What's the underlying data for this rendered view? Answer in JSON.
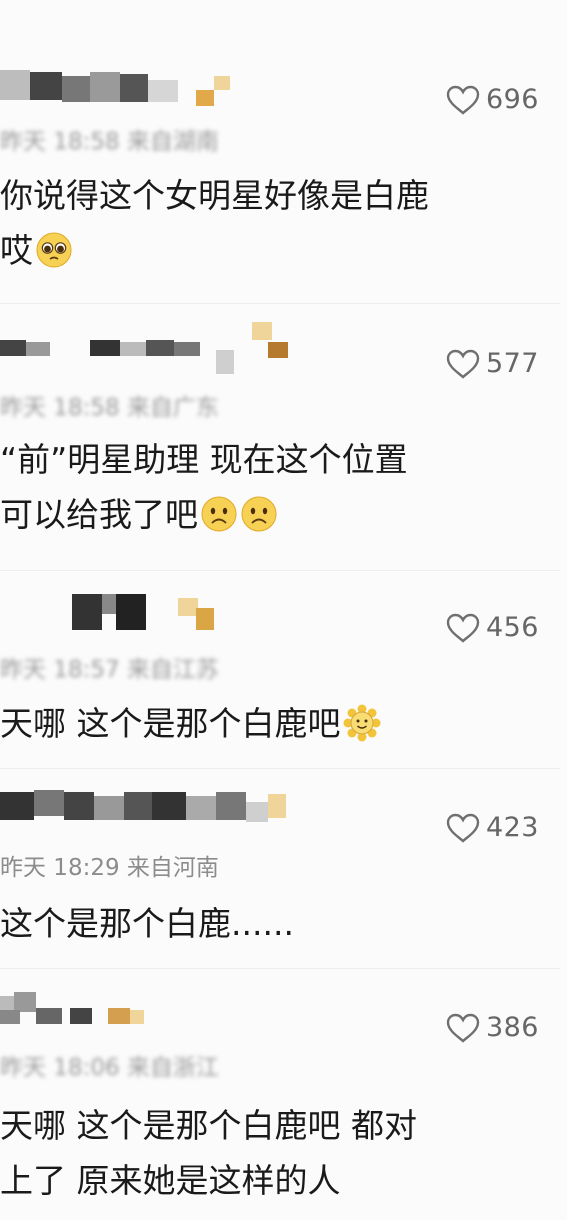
{
  "comments": [
    {
      "likes": "696",
      "meta": "昨天 18:58 来自湖南",
      "meta_obscured": true,
      "lines": [
        "你说得这个女明星好像是白鹿",
        "哎"
      ],
      "emojis": [
        "pleading-face"
      ]
    },
    {
      "likes": "577",
      "meta": "昨天 18:58 来自广东",
      "meta_obscured": true,
      "lines": [
        "“前”明星助理  现在这个位置",
        "可以给我了吧"
      ],
      "emojis": [
        "frowning-face",
        "frowning-face"
      ]
    },
    {
      "likes": "456",
      "meta": "昨天 18:57 来自江苏",
      "meta_obscured": true,
      "lines": [
        "天哪 这个是那个白鹿吧"
      ],
      "emojis": [
        "sunflower-smile"
      ]
    },
    {
      "likes": "423",
      "meta": "昨天 18:29 来自河南",
      "meta_obscured": false,
      "lines": [
        "这个是那个白鹿......"
      ],
      "emojis": []
    },
    {
      "likes": "386",
      "meta": "昨天 18:06 来自浙江",
      "meta_obscured": true,
      "lines": [
        "天哪 这个是那个白鹿吧 都对",
        "上了 原来她是这样的人"
      ],
      "emojis": []
    }
  ],
  "colors": {
    "heart": "#6f6f6f",
    "meta": "#8c8c8c",
    "text": "#1a1a1a",
    "pixel_accent": "#e2a94a"
  },
  "icons": {
    "like": "heart-outline-icon"
  }
}
